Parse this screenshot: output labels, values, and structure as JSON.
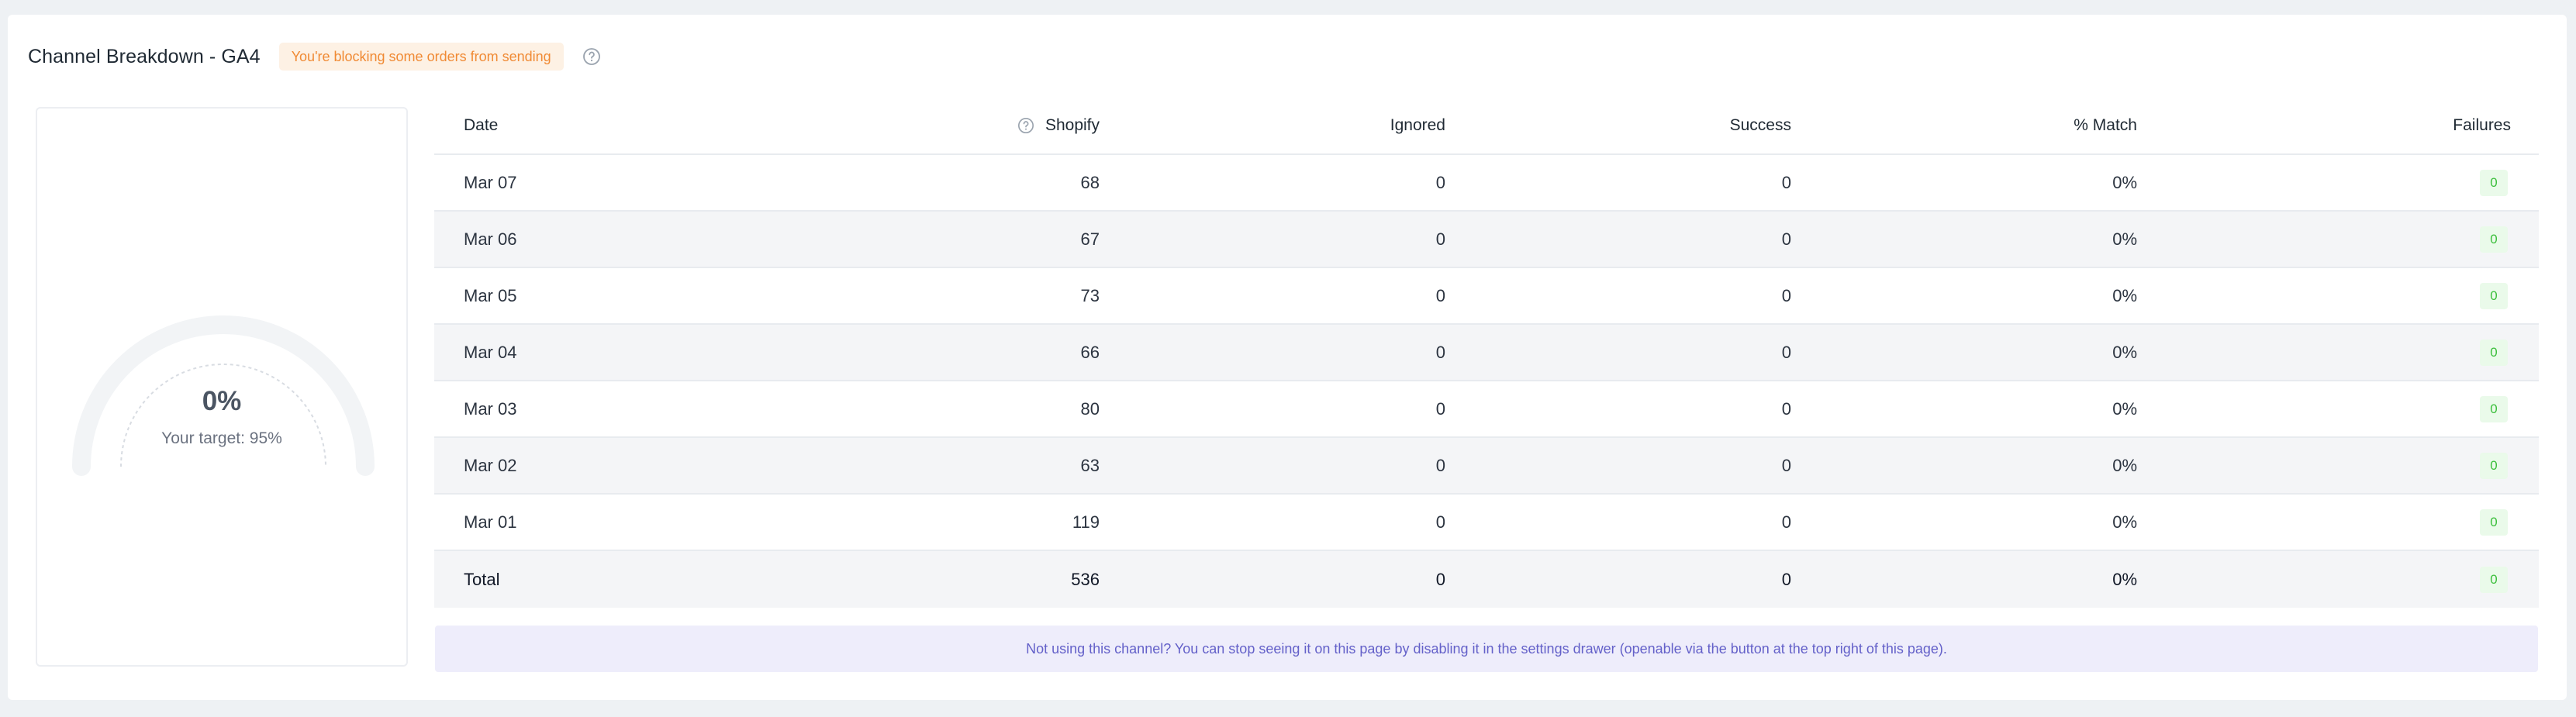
{
  "header": {
    "title": "Channel Breakdown - GA4",
    "warning": "You're blocking some orders from sending",
    "help_icon": "question-circle-icon"
  },
  "gauge": {
    "value_label": "0%",
    "target_label": "Your target: 95%",
    "value_fraction": 0,
    "target_fraction": 0.95,
    "track_color": "#f2f4f6",
    "dashed_color": "#d8dce2"
  },
  "table": {
    "columns": {
      "date": "Date",
      "shopify": "Shopify",
      "ignored": "Ignored",
      "success": "Success",
      "match": "% Match",
      "failures": "Failures"
    },
    "rows": [
      {
        "date": "Mar 07",
        "shopify": "68",
        "ignored": "0",
        "success": "0",
        "match": "0%",
        "failures": "0"
      },
      {
        "date": "Mar 06",
        "shopify": "67",
        "ignored": "0",
        "success": "0",
        "match": "0%",
        "failures": "0"
      },
      {
        "date": "Mar 05",
        "shopify": "73",
        "ignored": "0",
        "success": "0",
        "match": "0%",
        "failures": "0"
      },
      {
        "date": "Mar 04",
        "shopify": "66",
        "ignored": "0",
        "success": "0",
        "match": "0%",
        "failures": "0"
      },
      {
        "date": "Mar 03",
        "shopify": "80",
        "ignored": "0",
        "success": "0",
        "match": "0%",
        "failures": "0"
      },
      {
        "date": "Mar 02",
        "shopify": "63",
        "ignored": "0",
        "success": "0",
        "match": "0%",
        "failures": "0"
      },
      {
        "date": "Mar 01",
        "shopify": "119",
        "ignored": "0",
        "success": "0",
        "match": "0%",
        "failures": "0"
      }
    ],
    "total": {
      "date": "Total",
      "shopify": "536",
      "ignored": "0",
      "success": "0",
      "match": "0%",
      "failures": "0"
    }
  },
  "info": {
    "message": "Not using this channel? You can stop seeing it on this page by disabling it in the settings drawer (openable via the button at the top right of this page)."
  },
  "colors": {
    "warning_text": "#f08a34",
    "warning_bg": "#fdf1e4",
    "success_green": "#3bbf3b",
    "info_text": "#6461c9",
    "info_bg": "#eeedfb"
  }
}
